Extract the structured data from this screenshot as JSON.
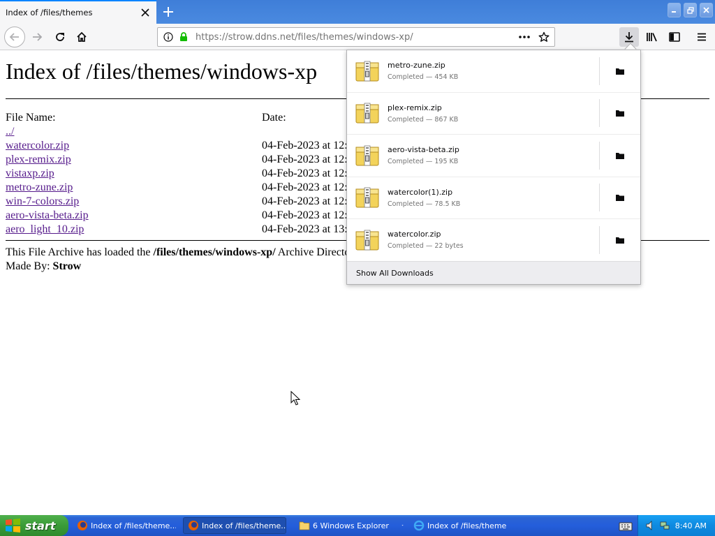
{
  "browser": {
    "tab_title": "Index of /files/themes",
    "url_host": "https://strow.ddns.net",
    "url_path": "/files/themes/windows-xp/"
  },
  "page": {
    "heading": "Index of /files/themes/windows-xp",
    "col_name": "File Name:",
    "col_date": "Date:",
    "parent_link": "../",
    "files": [
      {
        "name": "watercolor.zip",
        "date": "04-Feb-2023 at 12:"
      },
      {
        "name": "plex-remix.zip",
        "date": "04-Feb-2023 at 12:"
      },
      {
        "name": "vistaxp.zip",
        "date": "04-Feb-2023 at 12:"
      },
      {
        "name": "metro-zune.zip",
        "date": "04-Feb-2023 at 12:"
      },
      {
        "name": "win-7-colors.zip",
        "date": "04-Feb-2023 at 12:"
      },
      {
        "name": "aero-vista-beta.zip",
        "date": "04-Feb-2023 at 12:"
      },
      {
        "name": "aero_light_10.zip",
        "date": "04-Feb-2023 at 13:"
      }
    ],
    "footer_prefix": "This File Archive has loaded the ",
    "footer_dir": "/files/themes/windows-xp/",
    "footer_suffix": " Archive Directory o",
    "made_by_label": "Made By: ",
    "made_by_name": "Strow"
  },
  "downloads": {
    "items": [
      {
        "name": "metro-zune.zip",
        "status": "Completed — 454 KB"
      },
      {
        "name": "plex-remix.zip",
        "status": "Completed — 867 KB"
      },
      {
        "name": "aero-vista-beta.zip",
        "status": "Completed — 195 KB"
      },
      {
        "name": "watercolor(1).zip",
        "status": "Completed — 78.5 KB"
      },
      {
        "name": "watercolor.zip",
        "status": "Completed — 22 bytes"
      }
    ],
    "show_all": "Show All Downloads"
  },
  "taskbar": {
    "start_label": "start",
    "tasks": [
      {
        "label": "Index of /files/theme...",
        "icon": "firefox-icon"
      },
      {
        "label": "Index of /files/theme...",
        "icon": "firefox-icon"
      },
      {
        "label": "6 Windows Explorer",
        "icon": "folder-icon"
      },
      {
        "label": "Index of /files/theme...",
        "icon": "ie-icon"
      }
    ],
    "clock": "8:40 AM"
  }
}
